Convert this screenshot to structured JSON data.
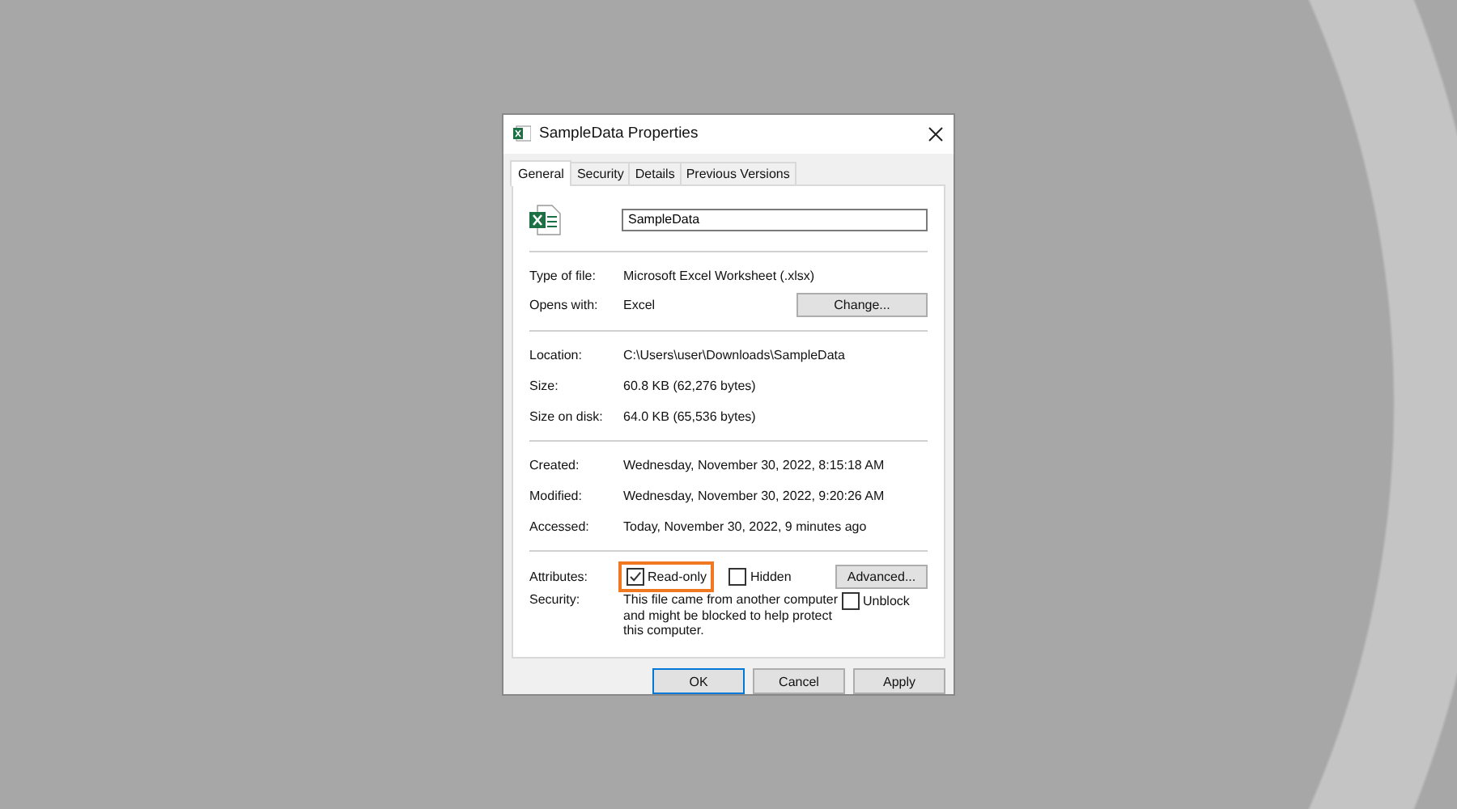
{
  "window": {
    "title": "SampleData Properties"
  },
  "tabs": [
    {
      "label": "General",
      "selected": true
    },
    {
      "label": "Security",
      "selected": false
    },
    {
      "label": "Details",
      "selected": false
    },
    {
      "label": "Previous Versions",
      "selected": false
    }
  ],
  "file_name": {
    "value": "SampleData"
  },
  "sections": [
    [
      {
        "label": "Type of file:",
        "value": "Microsoft Excel Worksheet (.xlsx)"
      },
      {
        "label": "Opens with:",
        "value": "Excel",
        "button": "Change..."
      }
    ],
    [
      {
        "label": "Location:",
        "value": "C:\\Users\\user\\Downloads\\SampleData"
      },
      {
        "label": "Size:",
        "value": "60.8 KB (62,276 bytes)"
      },
      {
        "label": "Size on disk:",
        "value": "64.0 KB (65,536 bytes)"
      }
    ],
    [
      {
        "label": "Created:",
        "value": "Wednesday, November 30, 2022, 8:15:18 AM"
      },
      {
        "label": "Modified:",
        "value": "Wednesday, November 30, 2022, 9:20:26 AM"
      },
      {
        "label": "Accessed:",
        "value": "Today, November 30, 2022, 9 minutes ago"
      }
    ]
  ],
  "attributes": {
    "label": "Attributes:",
    "checkboxes": [
      {
        "label": "Read-only",
        "checked": true,
        "highlighted": true
      },
      {
        "label": "Hidden",
        "checked": false
      }
    ],
    "button": "Advanced..."
  },
  "security": {
    "label": "Security:",
    "text": "This file came from another computer and might be blocked to help protect this computer.",
    "checkbox": {
      "label": "Unblock",
      "checked": false
    }
  },
  "buttons": [
    {
      "label": "OK",
      "default": true
    },
    {
      "label": "Cancel",
      "default": false
    },
    {
      "label": "Apply",
      "default": false
    }
  ]
}
